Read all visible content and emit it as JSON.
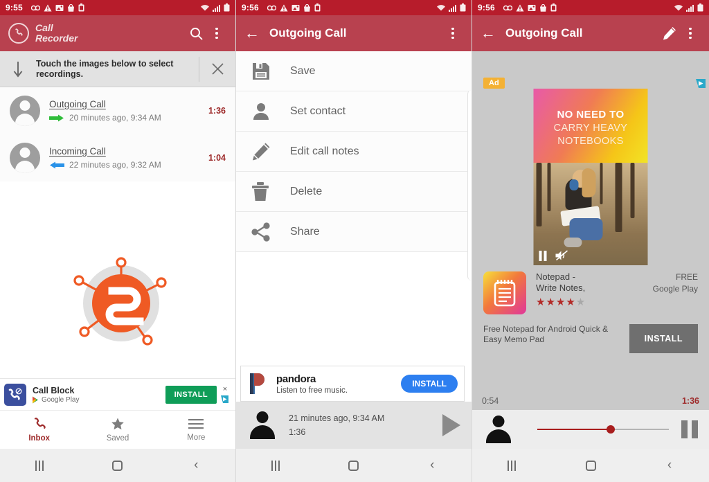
{
  "panel1": {
    "status": {
      "time": "9:55",
      "left_icons": [
        "voicemail-icon",
        "warning-icon",
        "image-icon",
        "shopping-bag-icon",
        "battery-saver-icon"
      ],
      "right_icons": [
        "wifi-icon",
        "signal-icon",
        "battery-icon"
      ]
    },
    "appbar": {
      "brand_line1": "Call",
      "brand_line2": "Recorder",
      "logo": "phone-in-circle-icon",
      "search": "search-icon",
      "overflow": "overflow-menu-icon"
    },
    "notice": {
      "arrow": "down-arrow-icon",
      "text": "Touch the images below to select recordings.",
      "close": "close-icon"
    },
    "calls": [
      {
        "title": "Outgoing Call",
        "direction": "outgoing",
        "subtitle": "20 minutes ago, 9:34 AM",
        "duration": "1:36"
      },
      {
        "title": "Incoming Call",
        "direction": "incoming",
        "subtitle": "22 minutes ago, 9:32 AM",
        "duration": "1:04"
      }
    ],
    "ad": {
      "title": "Call Block",
      "store": "Google Play",
      "cta": "INSTALL",
      "close": "×",
      "adchoices": "adchoices-icon"
    },
    "nav": [
      {
        "label": "Inbox",
        "icon": "phone-icon",
        "active": true
      },
      {
        "label": "Saved",
        "icon": "star-icon",
        "active": false
      },
      {
        "label": "More",
        "icon": "hamburger-icon",
        "active": false
      }
    ]
  },
  "panel2": {
    "status": {
      "time": "9:56"
    },
    "appbar": {
      "back": "back-arrow-icon",
      "title": "Outgoing Call",
      "overflow": "overflow-menu-icon"
    },
    "menu": [
      {
        "label": "Save",
        "icon": "save-icon"
      },
      {
        "label": "Set contact",
        "icon": "person-icon"
      },
      {
        "label": "Edit call notes",
        "icon": "pencil-icon"
      },
      {
        "label": "Delete",
        "icon": "trash-icon"
      },
      {
        "label": "Share",
        "icon": "share-icon"
      }
    ],
    "ad": {
      "title": "pandora",
      "subtitle": "Listen to free music.",
      "cta": "INSTALL"
    },
    "player": {
      "subtitle": "21 minutes ago, 9:34 AM",
      "duration": "1:36",
      "action": "play-icon"
    }
  },
  "panel3": {
    "status": {
      "time": "9:56"
    },
    "appbar": {
      "back": "back-arrow-icon",
      "title": "Outgoing Call",
      "edit": "pencil-icon",
      "overflow": "overflow-menu-icon"
    },
    "ad": {
      "badge": "Ad",
      "adchoices": "adchoices-icon",
      "headline1": "NO NEED TO",
      "headline2": "CARRY HEAVY",
      "headline3": "NOTEBOOKS",
      "video_controls": [
        "pause-icon",
        "mute-icon"
      ],
      "app_name_line1": "Notepad -",
      "app_name_line2": "Write Notes,",
      "rating": 4,
      "rating_max": 5,
      "price": "FREE",
      "store": "Google Play",
      "description": "Free Notepad for Android Quick & Easy Memo Pad",
      "cta": "INSTALL"
    },
    "player": {
      "elapsed": "0:54",
      "total": "1:36",
      "progress_percent": 56,
      "action": "pause-icon"
    }
  },
  "sysnav": {
    "recents": "recents-icon",
    "home": "home-icon",
    "back": "back-icon"
  },
  "colors": {
    "status_bar": "#b71c2b",
    "app_bar": "#b8414f",
    "accent_red": "#9e2b2b",
    "ad_gray": "#c9c9c9",
    "install_green": "#0f9d58",
    "install_blue": "#2d7ff0"
  }
}
